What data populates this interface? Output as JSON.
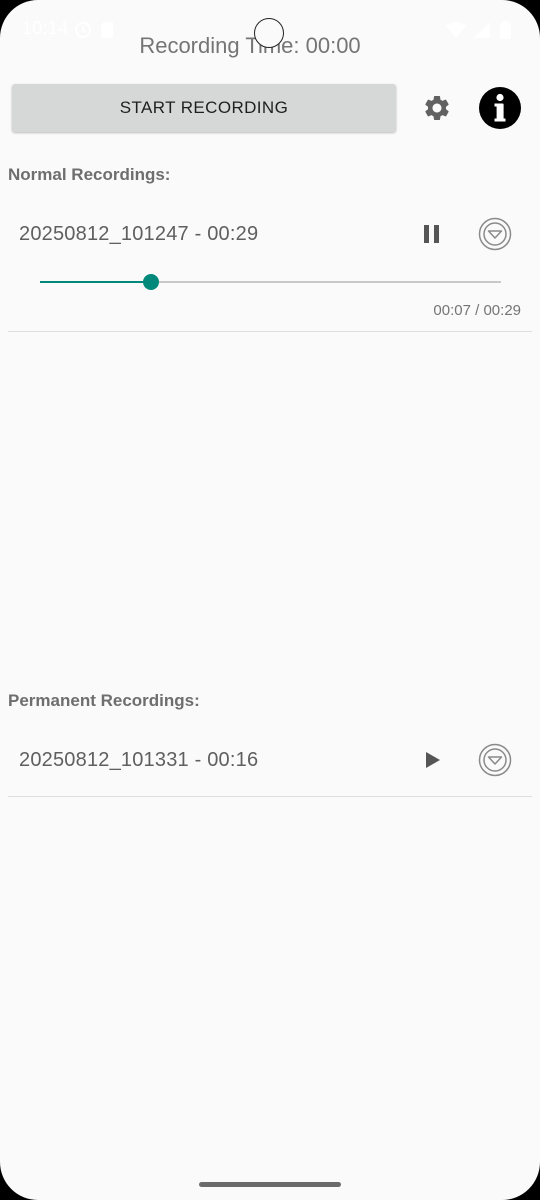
{
  "status_bar": {
    "time": "10:14",
    "icons_left": [
      "alarm-icon",
      "sim-card-icon"
    ],
    "icons_right": [
      "wifi-icon",
      "signal-icon",
      "battery-icon"
    ]
  },
  "recording_time": {
    "label": "Recording Time: 00:00"
  },
  "toolbar": {
    "start_label": "START RECORDING",
    "settings_icon": "gear-icon",
    "info_icon": "info-icon"
  },
  "sections": {
    "normal": {
      "title": "Normal Recordings:",
      "items": [
        {
          "name": "20250812_101247 - 00:29",
          "state": "playing",
          "action_icon": "pause-icon",
          "menu_icon": "dropdown-circle-icon",
          "progress": {
            "label": "00:07 / 00:29",
            "position_fraction": 0.241
          }
        }
      ]
    },
    "permanent": {
      "title": "Permanent Recordings:",
      "items": [
        {
          "name": "20250812_101331 - 00:16",
          "state": "stopped",
          "action_icon": "play-icon",
          "menu_icon": "dropdown-circle-icon"
        }
      ]
    }
  },
  "colors": {
    "accent": "#00897b",
    "background": "#fafafa",
    "button": "#d6d7d7",
    "text_secondary": "#757575"
  }
}
